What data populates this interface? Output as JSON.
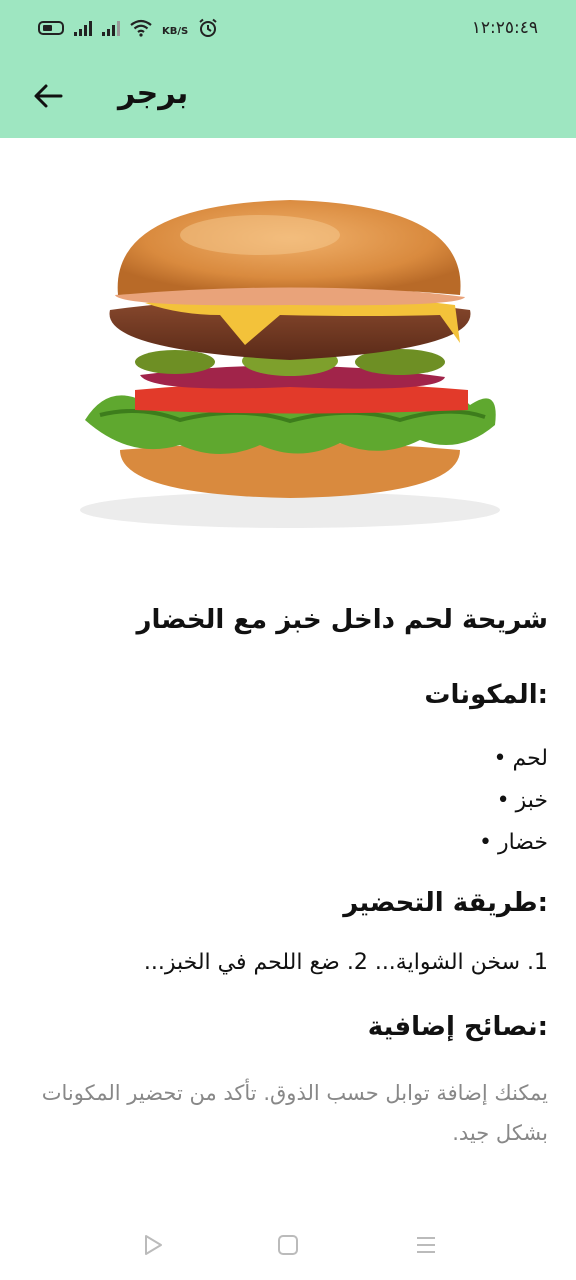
{
  "status_bar": {
    "time": "١٢:٢٥:٤٩",
    "battery_label": "35",
    "net_speed_unit": "KB/S",
    "icons": [
      "battery-icon",
      "signal-icon",
      "signal-icon",
      "wifi-icon",
      "alarm-icon"
    ]
  },
  "app_bar": {
    "title": "برجر",
    "back_icon": "arrow-left-icon"
  },
  "hero_image": {
    "subject": "burger-photo"
  },
  "recipe": {
    "description": "شريحة لحم داخل خبز مع الخضار",
    "ingredients_heading": ":المكونات",
    "ingredients": [
      "لحم",
      "خبز",
      "خضار"
    ],
    "bullet": "•",
    "preparation_heading": ":طريقة التحضير",
    "preparation_text": "1. سخن الشواية... 2. ضع اللحم في الخبز...",
    "tips_heading": ":نصائح إضافية",
    "tips_text": "يمكنك إضافة توابل حسب الذوق. تأكد من تحضير المكونات بشكل جيد."
  },
  "nav_bar": {
    "icons": [
      "back-triangle-icon",
      "home-square-icon",
      "menu-lines-icon"
    ]
  },
  "colors": {
    "header_bg": "#9ee6c1",
    "tips_text": "#888888"
  }
}
